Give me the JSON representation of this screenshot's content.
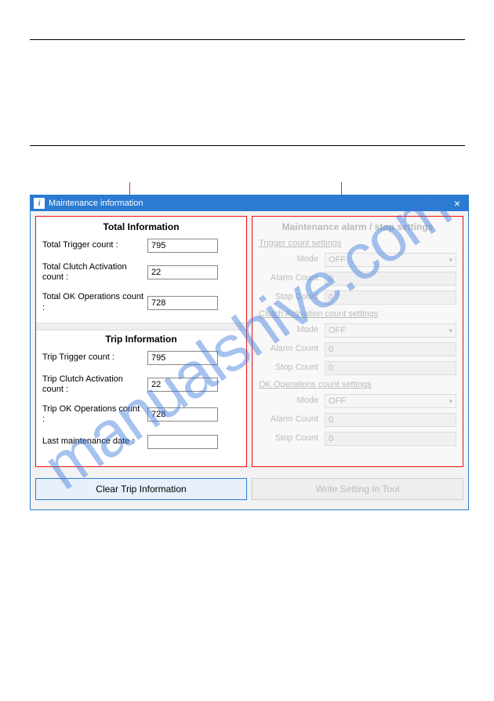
{
  "window": {
    "title": "Maintenance information",
    "icon_text": "i",
    "close_label": "×"
  },
  "left_panel": {
    "total": {
      "heading": "Total Information",
      "trigger_label": "Total Trigger count :",
      "trigger_value": "795",
      "clutch_label": "Total Clutch Activation count :",
      "clutch_value": "22",
      "ok_label": "Total OK Operations count :",
      "ok_value": "728"
    },
    "trip": {
      "heading": "Trip Information",
      "trigger_label": "Trip Trigger count :",
      "trigger_value": "795",
      "clutch_label": "Trip Clutch Activation count :",
      "clutch_value": "22",
      "ok_label": "Trip OK Operations count :",
      "ok_value": "728",
      "last_label": "Last maintenance date :",
      "last_value": ""
    }
  },
  "right_panel": {
    "heading": "Maintenance alarm / stop settings",
    "trigger": {
      "heading": "Trigger count settings",
      "mode_label": "Mode",
      "mode_value": "OFF",
      "alarm_label": "Alarm Count",
      "alarm_value": "0",
      "stop_label": "Stop Count",
      "stop_value": "0"
    },
    "clutch": {
      "heading": "Clutch Activation count settings",
      "mode_label": "Mode",
      "mode_value": "OFF",
      "alarm_label": "Alarm Count",
      "alarm_value": "0",
      "stop_label": "Stop Count",
      "stop_value": "0"
    },
    "ok": {
      "heading": "OK Operations count settings",
      "mode_label": "Mode",
      "mode_value": "OFF",
      "alarm_label": "Alarm Count",
      "alarm_value": "0",
      "stop_label": "Stop Count",
      "stop_value": "0"
    }
  },
  "buttons": {
    "clear": "Clear Trip Information",
    "write": "Write Setting In Tool"
  },
  "watermark": "manualshive.com"
}
